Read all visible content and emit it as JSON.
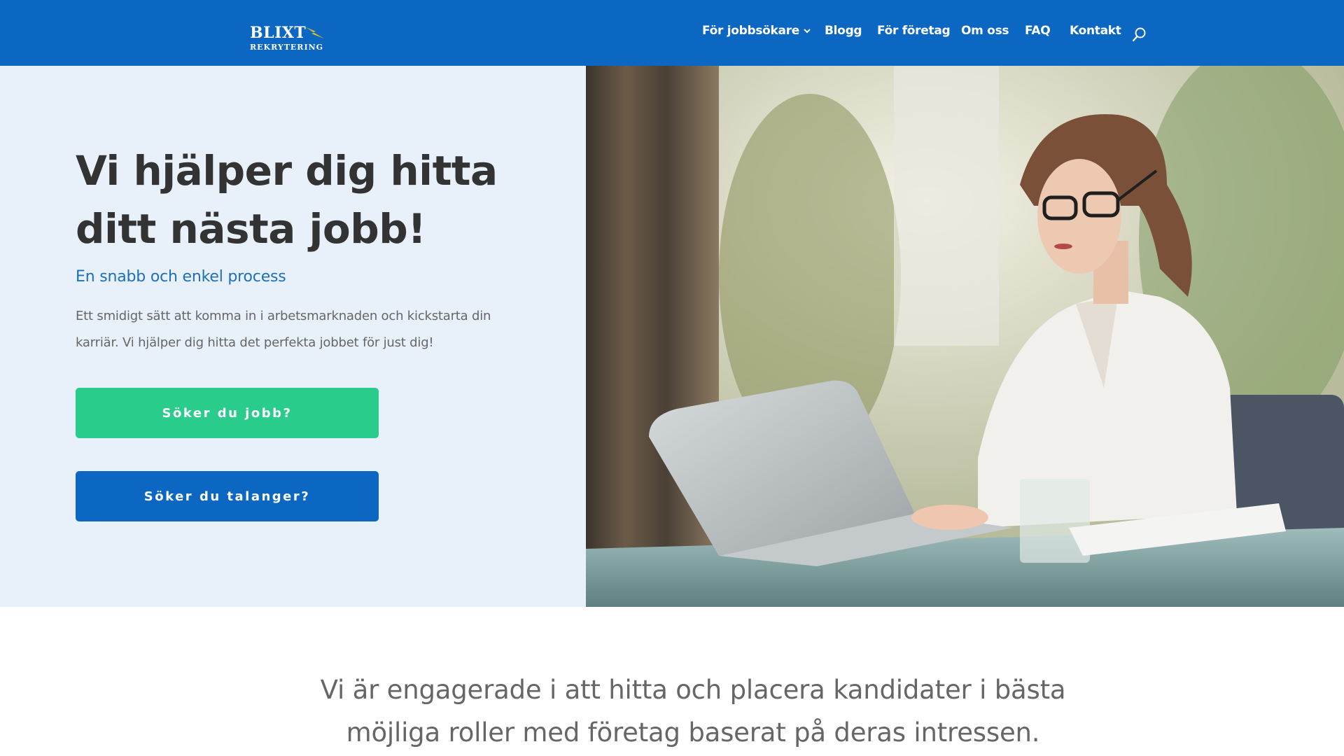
{
  "header": {
    "logo": {
      "line1": "BLIXT",
      "line2": "REKRYTERING"
    },
    "nav": [
      {
        "label": "För jobbsökare",
        "has_dropdown": true
      },
      {
        "label": "Blogg"
      },
      {
        "label": "För företag"
      },
      {
        "label": "Om oss"
      },
      {
        "label": "FAQ"
      },
      {
        "label": "Kontakt"
      }
    ],
    "search_icon": "search-icon"
  },
  "hero": {
    "title": "Vi hjälper dig hitta ditt nästa jobb!",
    "subtitle": "En snabb och enkel process",
    "description": "Ett smidigt sätt att komma in i arbetsmarknaden och kickstarta din karriär. Vi hjälper dig hitta det perfekta jobbet för just dig!",
    "buttons": {
      "jobs": "Söker du jobb?",
      "talent": "Söker du talanger?"
    },
    "image": "woman-typing-on-laptop-photo"
  },
  "mission": {
    "text": "Vi är engagerade i att hitta och placera kandidater i bästa möjliga roller med företag baserat på deras intressen."
  },
  "colors": {
    "header_bg": "#0c67c2",
    "hero_bg": "#e8f1fa",
    "primary_button": "#29cc8b",
    "secondary_button": "#0c67c2",
    "subtitle": "#1e6fb8",
    "heading_text": "#333333",
    "body_text": "#666666"
  }
}
